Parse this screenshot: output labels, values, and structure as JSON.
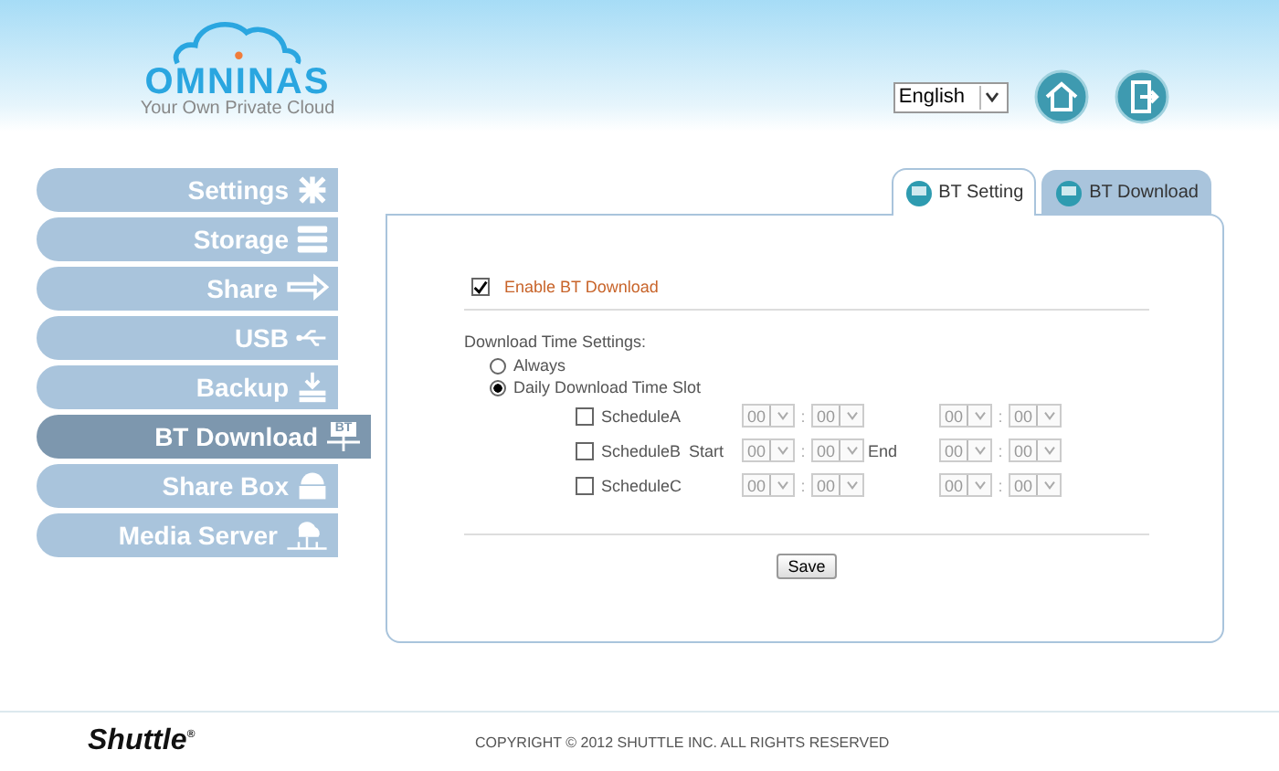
{
  "logo": {
    "name": "OMNINAS",
    "tagline": "Your Own Private Cloud"
  },
  "language": {
    "value": "English"
  },
  "sidebar": {
    "items": [
      {
        "label": "Settings",
        "kind": "tools",
        "selected": false
      },
      {
        "label": "Storage",
        "kind": "stack",
        "selected": false
      },
      {
        "label": "Share",
        "kind": "arrows",
        "selected": false
      },
      {
        "label": "USB",
        "kind": "usb",
        "selected": false
      },
      {
        "label": "Backup",
        "kind": "download",
        "selected": false
      },
      {
        "label": "BT Download",
        "kind": "bt",
        "badge": "BT",
        "selected": true
      },
      {
        "label": "Share Box",
        "kind": "box",
        "selected": false
      },
      {
        "label": "Media Server",
        "kind": "media",
        "selected": false
      }
    ]
  },
  "tabs": [
    {
      "label": "BT Setting",
      "selected": true
    },
    {
      "label": "BT Download",
      "selected": false
    }
  ],
  "enable": {
    "label": "Enable BT Download",
    "checked": true
  },
  "time_settings": {
    "heading": "Download Time Settings:",
    "options": [
      {
        "label": "Always",
        "selected": false
      },
      {
        "label": "Daily Download Time Slot",
        "selected": true
      }
    ],
    "schedules": [
      {
        "label": "ScheduleA",
        "checked": false,
        "start": [
          "00",
          "00"
        ],
        "start_separator": ":",
        "end": [
          "00",
          "00"
        ],
        "end_separator": ":",
        "disabled": true
      },
      {
        "label": "ScheduleB",
        "checked": false,
        "start_label": "Start",
        "end_label": "End",
        "start": [
          "00",
          "00"
        ],
        "start_separator": ":",
        "end": [
          "00",
          "00"
        ],
        "end_separator": ":",
        "disabled": true
      },
      {
        "label": "ScheduleC",
        "checked": false,
        "start": [
          "00",
          "00"
        ],
        "start_separator": ":",
        "end": [
          "00",
          "00"
        ],
        "end_separator": ":",
        "disabled": true
      }
    ]
  },
  "save_button": "Save",
  "footer": {
    "brand": "Shuttle",
    "brand_mark": "®",
    "copyright": "COPYRIGHT © 2012 SHUTTLE INC. ALL RIGHTS RESERVED"
  }
}
